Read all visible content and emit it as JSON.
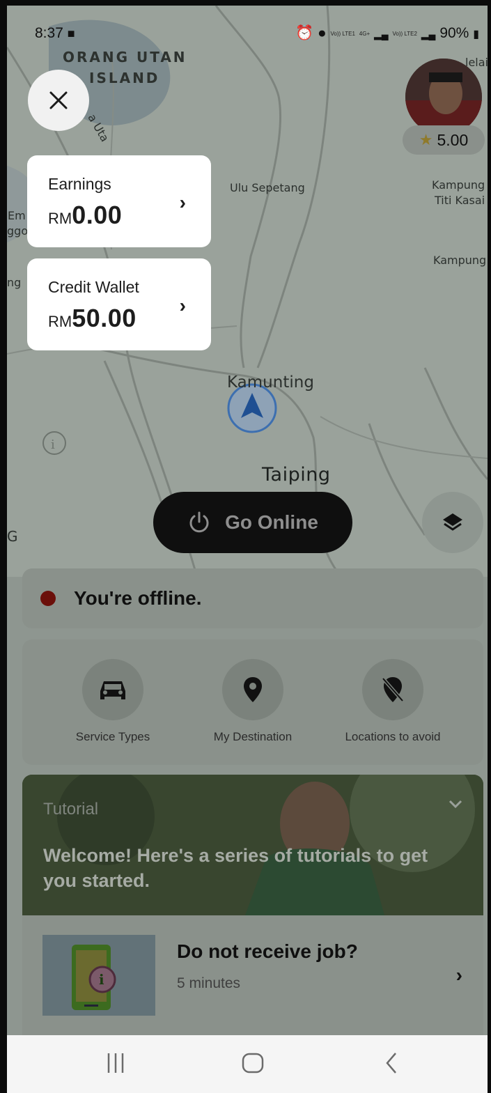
{
  "status_bar": {
    "time": "8:37",
    "battery": "90%",
    "sim1": "Vo)) LTE1",
    "sim2": "Vo)) LTE2",
    "network": "4G+"
  },
  "map": {
    "labels": {
      "orang_utan": "ORANG UTAN",
      "island": "ISLAND",
      "road": "a Uta",
      "ulu_sepetang": "Ulu Sepetang",
      "kampung_titi_1": "Kampung",
      "kampung_titi_2": "Titi Kasai",
      "kampung": "Kampung",
      "kamunting": "Kamunting",
      "taiping": "Taiping",
      "edge_em": "Em",
      "edge_ggo": "ggo",
      "edge_ng": "ng",
      "edge_g": "G",
      "edge_lelai": "lelai"
    }
  },
  "rating": "5.00",
  "earnings": {
    "title": "Earnings",
    "currency": "RM",
    "amount": "0.00"
  },
  "credit_wallet": {
    "title": "Credit Wallet",
    "currency": "RM",
    "amount": "50.00"
  },
  "go_online_label": "Go Online",
  "offline_status": "You're offline.",
  "quick_actions": [
    {
      "label": "Service Types",
      "icon": "car-icon"
    },
    {
      "label": "My Destination",
      "icon": "location-pin-icon"
    },
    {
      "label": "Locations to avoid",
      "icon": "location-off-icon"
    }
  ],
  "tutorial": {
    "label": "Tutorial",
    "headline": "Welcome! Here's a series of tutorials to get you started.",
    "item_title": "Do not receive job?",
    "item_duration": "5 minutes"
  },
  "colors": {
    "overlay_dim": "#000000",
    "offline_dot": "#d0231a",
    "go_online_bg": "#111111"
  }
}
